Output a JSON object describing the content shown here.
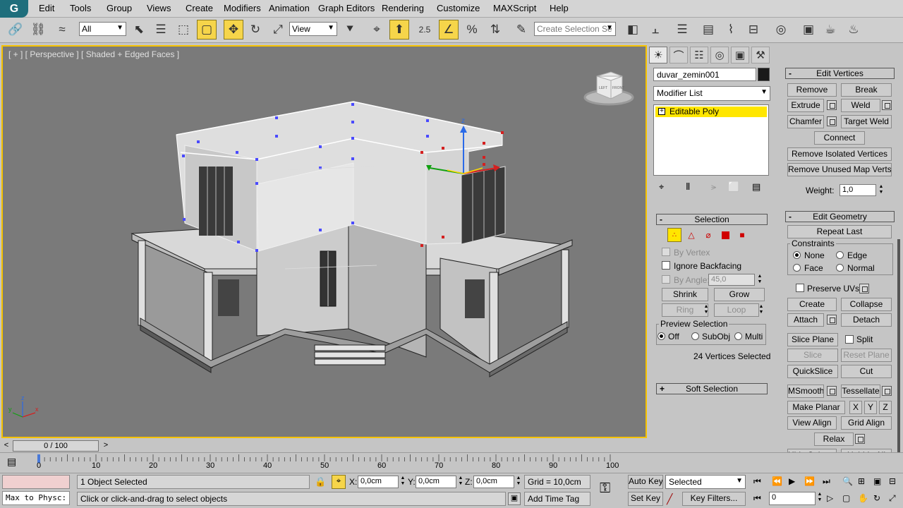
{
  "menu": {
    "logo": "G",
    "items": [
      "Edit",
      "Tools",
      "Group",
      "Views",
      "Create",
      "Modifiers",
      "Animation",
      "Graph Editors",
      "Rendering",
      "Customize",
      "MAXScript",
      "Help"
    ]
  },
  "toolbar": {
    "filter_value": "All",
    "coord_value": "View",
    "snap_label": "2.5",
    "selection_set_placeholder": "Create Selection Se"
  },
  "viewport": {
    "label": "[ + ] [ Perspective ] [ Shaded + Edged Faces ]",
    "viewcube_labels": [
      "LEFT",
      "FRONT"
    ],
    "gizmo_axis_label": "z",
    "axis_labels": {
      "x": "x",
      "y": "y",
      "z": "z"
    }
  },
  "command_panel": {
    "object_name": "duvar_zemin001",
    "object_color": "#1a1a1a",
    "modifier_list_label": "Modifier List",
    "stack_item": "Editable Poly",
    "edit_vertices": {
      "title": "Edit Vertices",
      "remove": "Remove",
      "break": "Break",
      "extrude": "Extrude",
      "weld": "Weld",
      "chamfer": "Chamfer",
      "target_weld": "Target Weld",
      "connect": "Connect",
      "remove_isolated": "Remove Isolated Vertices",
      "remove_unused_map": "Remove Unused Map Verts",
      "weight_label": "Weight:",
      "weight_value": "1,0"
    },
    "selection": {
      "title": "Selection",
      "by_vertex": "By Vertex",
      "ignore_backfacing": "Ignore Backfacing",
      "by_angle": "By Angle:",
      "angle_value": "45,0",
      "shrink": "Shrink",
      "grow": "Grow",
      "ring": "Ring",
      "loop": "Loop",
      "preview_title": "Preview Selection",
      "preview_off": "Off",
      "preview_subobj": "SubObj",
      "preview_multi": "Multi",
      "status": "24 Vertices Selected"
    },
    "soft_selection_title": "Soft Selection",
    "edit_geometry": {
      "title": "Edit Geometry",
      "repeat_last": "Repeat Last",
      "constraints_title": "Constraints",
      "none": "None",
      "edge": "Edge",
      "face": "Face",
      "normal": "Normal",
      "preserve_uvs": "Preserve UVs",
      "create": "Create",
      "collapse": "Collapse",
      "attach": "Attach",
      "detach": "Detach",
      "slice_plane": "Slice Plane",
      "split": "Split",
      "slice": "Slice",
      "reset_plane": "Reset Plane",
      "quickslice": "QuickSlice",
      "cut": "Cut",
      "msmooth": "MSmooth",
      "tessellate": "Tessellate",
      "make_planar": "Make Planar",
      "x": "X",
      "y": "Y",
      "z": "Z",
      "view_align": "View Align",
      "grid_align": "Grid Align",
      "relax": "Relax",
      "hide_selected": "Hide Selected",
      "unhide_all": "Unhide All"
    }
  },
  "timeline": {
    "frame_display": "0 / 100",
    "ticks": [
      "0",
      "10",
      "20",
      "30",
      "40",
      "50",
      "60",
      "70",
      "80",
      "90",
      "100"
    ],
    "current_frame": 0,
    "total_frames": 100
  },
  "status": {
    "maxscript_text": "Max to Physc:",
    "objects_selected": "1 Object Selected",
    "prompt": "Click or click-and-drag to select objects",
    "x_label": "X:",
    "x_value": "0,0cm",
    "y_label": "Y:",
    "y_value": "0,0cm",
    "z_label": "Z:",
    "z_value": "0,0cm",
    "grid": "Grid = 10,0cm",
    "add_time_tag": "Add Time Tag",
    "auto_key": "Auto Key",
    "set_key": "Set Key",
    "key_mode_value": "Selected",
    "key_filters": "Key Filters...",
    "frame_value": "0"
  }
}
